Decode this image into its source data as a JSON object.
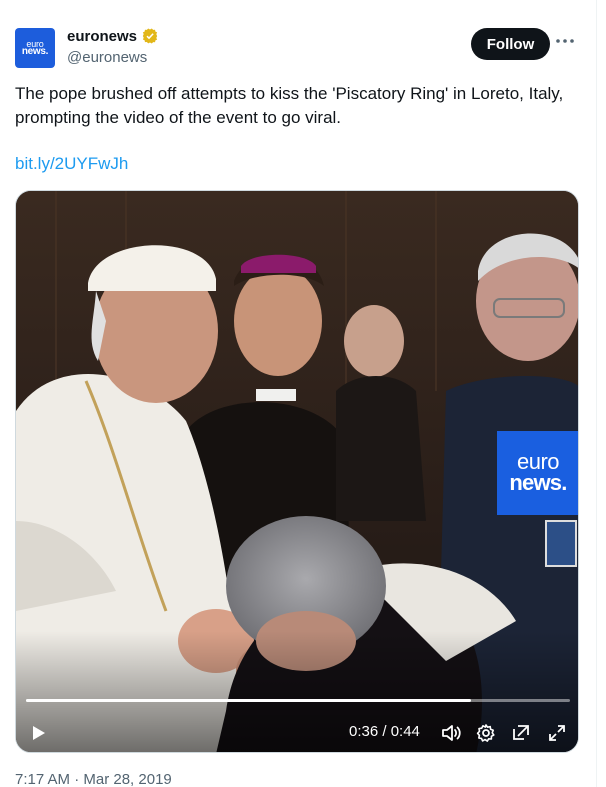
{
  "author": {
    "display_name": "euronews",
    "handle": "@euronews",
    "avatar_line1": "euro",
    "avatar_line2": "news.",
    "verified_icon": "verified-badge-gold"
  },
  "actions": {
    "follow_label": "Follow",
    "more_icon": "more-horizontal-icon"
  },
  "tweet": {
    "text": "The pope brushed off attempts to kiss the 'Piscatory Ring' in Loreto, Italy, prompting the video of the event to go viral.",
    "link": "bit.ly/2UYFwJh",
    "timestamp": "7:17 AM · Mar 28, 2019"
  },
  "video": {
    "watermark_line1": "euro",
    "watermark_line2": "news.",
    "current_time": "0:36",
    "duration": "0:44",
    "time_display": "0:36 / 0:44",
    "progress_fraction": 0.818,
    "controls": [
      "play-icon",
      "volume-icon",
      "settings-icon",
      "pop-out-icon",
      "fullscreen-icon"
    ]
  },
  "colors": {
    "accent": "#1d9bf0",
    "brand": "#1a5fe0",
    "verified": "#e2b719",
    "text_secondary": "#536471"
  }
}
